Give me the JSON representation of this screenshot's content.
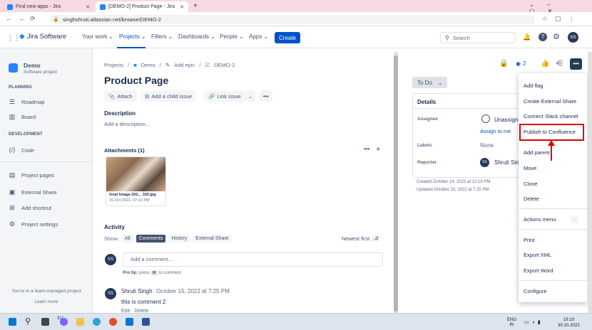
{
  "browser": {
    "tabs": [
      {
        "title": "Find new apps - Jira"
      },
      {
        "title": "[DEMO-2] Product Page - Jira"
      }
    ],
    "url": "singhshruti.atlassian.net/browse/DEMO-2"
  },
  "nav": {
    "logo": "Jira Software",
    "items": [
      "Your work",
      "Projects",
      "Filters",
      "Dashboards",
      "People",
      "Apps"
    ],
    "create": "Create",
    "search_placeholder": "Search",
    "avatar": "SS"
  },
  "sidebar": {
    "project_name": "Demo",
    "project_type": "Software project",
    "planning_heading": "PLANNING",
    "planning": [
      "Roadmap",
      "Board"
    ],
    "development_heading": "DEVELOPMENT",
    "development": [
      "Code"
    ],
    "other": [
      "Project pages",
      "External Share",
      "Add shortcut",
      "Project settings"
    ],
    "footer": "You're in a team-managed project",
    "learn_more": "Learn more"
  },
  "issue": {
    "breadcrumb": [
      "Projects",
      "Demo",
      "Add epic",
      "DEMO-2"
    ],
    "title": "Product Page",
    "actions": [
      "Attach",
      "Add a child issue",
      "Link issue"
    ],
    "description_label": "Description",
    "description_placeholder": "Add a description...",
    "attachments_label": "Attachments (1)",
    "attachment": {
      "name": "Goal Image-202... 320.jpg",
      "date": "15 Oct 2022, 07:13 PM"
    },
    "activity_label": "Activity",
    "show_label": "Show:",
    "filters": [
      "All",
      "Comments",
      "History",
      "External Share"
    ],
    "sort": "Newest first",
    "comment_placeholder": "Add a comment...",
    "pro_tip": "Pro tip:",
    "pro_tip_text": "press",
    "pro_tip_key": "M",
    "pro_tip_suffix": "to comment",
    "comment": {
      "author": "Shruti Singh",
      "date": "October 15, 2022 at 7:25 PM",
      "text": "this is comment 2",
      "actions": "Edit · Delete · "
    }
  },
  "details": {
    "status": "To Do",
    "watch_count": "2",
    "heading": "Details",
    "assignee_label": "Assignee",
    "assignee_value": "Unassigned",
    "assign_to_me": "Assign to me",
    "labels_label": "Labels",
    "labels_value": "None",
    "reporter_label": "Reporter",
    "reporter_value": "Shruti Singh",
    "created": "Created October 14, 2022 at 12:19 PM",
    "updated": "Updated October 15, 2022 at 7:25 PM"
  },
  "menu": {
    "items": [
      "Add flag",
      "Create External Share",
      "Connect Slack channel",
      "Publish to Confluence",
      "Add parent",
      "Move",
      "Clone",
      "Delete",
      "Actions menu",
      "Print",
      "Export XML",
      "Export Word",
      "Configure"
    ],
    "highlighted": "Publish to Confluence",
    "highlight_color": "#e00000"
  },
  "taskbar": {
    "weather": "31°",
    "lang": "ENG",
    "region": "IN",
    "time": "19:19",
    "date": "30-10-2022"
  }
}
